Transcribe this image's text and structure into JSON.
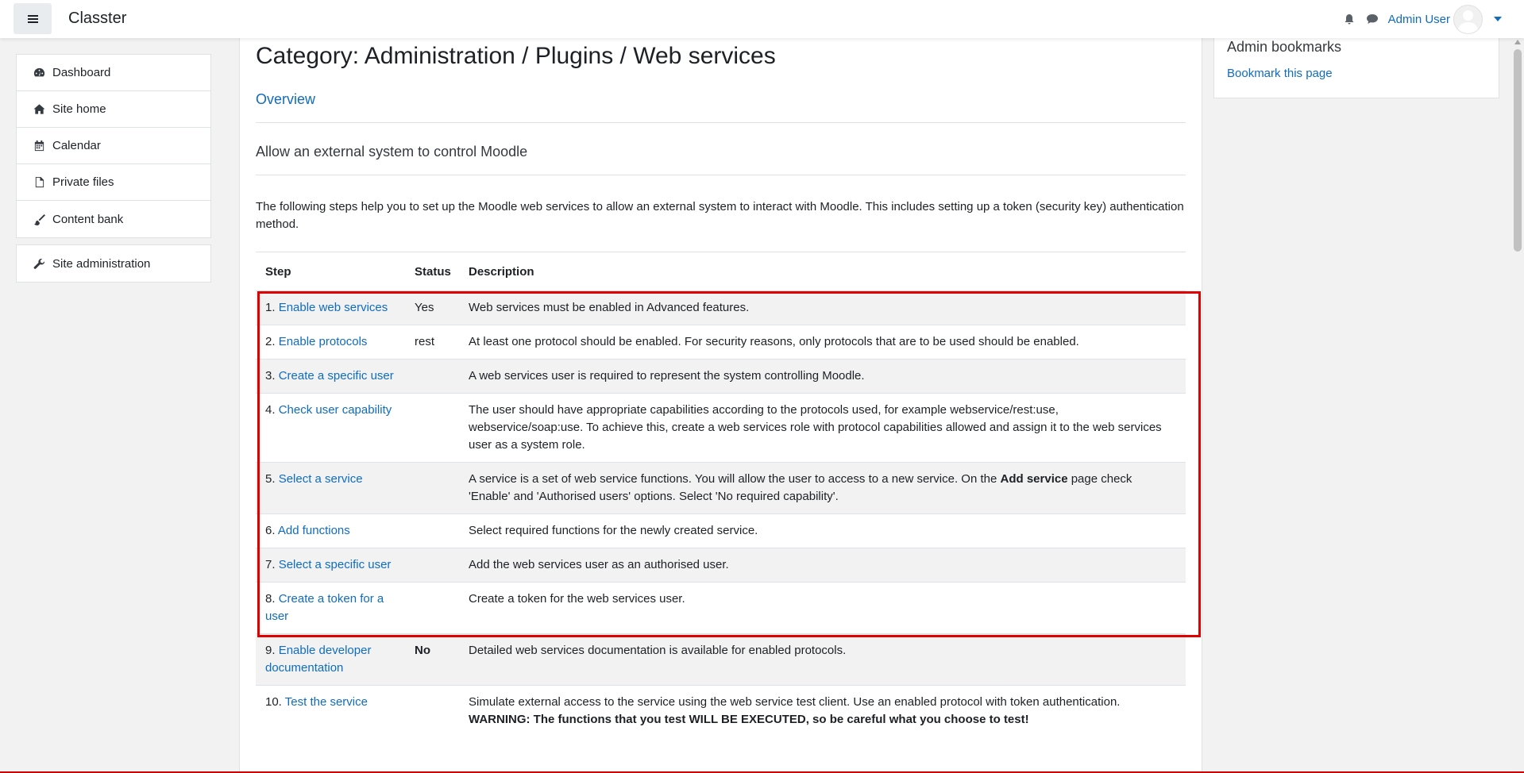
{
  "navbar": {
    "brand": "Classter",
    "username": "Admin User"
  },
  "drawer": {
    "items": [
      {
        "label": "Dashboard",
        "icon": "dashboard-icon"
      },
      {
        "label": "Site home",
        "icon": "home-icon"
      },
      {
        "label": "Calendar",
        "icon": "calendar-icon"
      },
      {
        "label": "Private files",
        "icon": "file-icon"
      },
      {
        "label": "Content bank",
        "icon": "brush-icon"
      }
    ],
    "admin": {
      "label": "Site administration",
      "icon": "wrench-icon"
    }
  },
  "main": {
    "title": "Category: Administration / Plugins / Web services",
    "overview": "Overview",
    "subhead": "Allow an external system to control Moodle",
    "intro": "The following steps help you to set up the Moodle web services to allow an external system to interact with Moodle. This includes setting up a token (security key) authentication method.",
    "table": {
      "headers": {
        "step": "Step",
        "status": "Status",
        "description": "Description"
      },
      "rows": [
        {
          "num": "1.",
          "link": "Enable web services",
          "status": "Yes",
          "desc": "Web services must be enabled in Advanced features."
        },
        {
          "num": "2.",
          "link": "Enable protocols",
          "status": "rest",
          "desc": "At least one protocol should be enabled. For security reasons, only protocols that are to be used should be enabled."
        },
        {
          "num": "3.",
          "link": "Create a specific user",
          "status": "",
          "desc": "A web services user is required to represent the system controlling Moodle."
        },
        {
          "num": "4.",
          "link": "Check user capability",
          "status": "",
          "desc": "The user should have appropriate capabilities according to the protocols used, for example webservice/rest:use, webservice/soap:use. To achieve this, create a web services role with protocol capabilities allowed and assign it to the web services user as a system role."
        },
        {
          "num": "5.",
          "link": "Select a service",
          "status": "",
          "desc_a": "A service is a set of web service functions. You will allow the user to access to a new service. On the ",
          "desc_b": "Add service",
          "desc_c": " page check 'Enable' and 'Authorised users' options. Select 'No required capability'."
        },
        {
          "num": "6.",
          "link": "Add functions",
          "status": "",
          "desc": "Select required functions for the newly created service."
        },
        {
          "num": "7.",
          "link": "Select a specific user",
          "status": "",
          "desc": "Add the web services user as an authorised user."
        },
        {
          "num": "8.",
          "link": "Create a token for a user",
          "status": "",
          "desc": "Create a token for the web services user."
        },
        {
          "num": "9.",
          "link": "Enable developer documentation",
          "status": "No",
          "desc": "Detailed web services documentation is available for enabled protocols."
        },
        {
          "num": "10.",
          "link": "Test the service",
          "status": "",
          "desc": "Simulate external access to the service using the web service test client. Use an enabled protocol with token authentication.",
          "warning": "WARNING: The functions that you test WILL BE EXECUTED, so be careful what you choose to test!"
        }
      ]
    }
  },
  "block": {
    "title": "Admin bookmarks",
    "link": "Bookmark this page"
  },
  "colors": {
    "accent": "#0f6cbf",
    "highlight": "#e00000"
  }
}
